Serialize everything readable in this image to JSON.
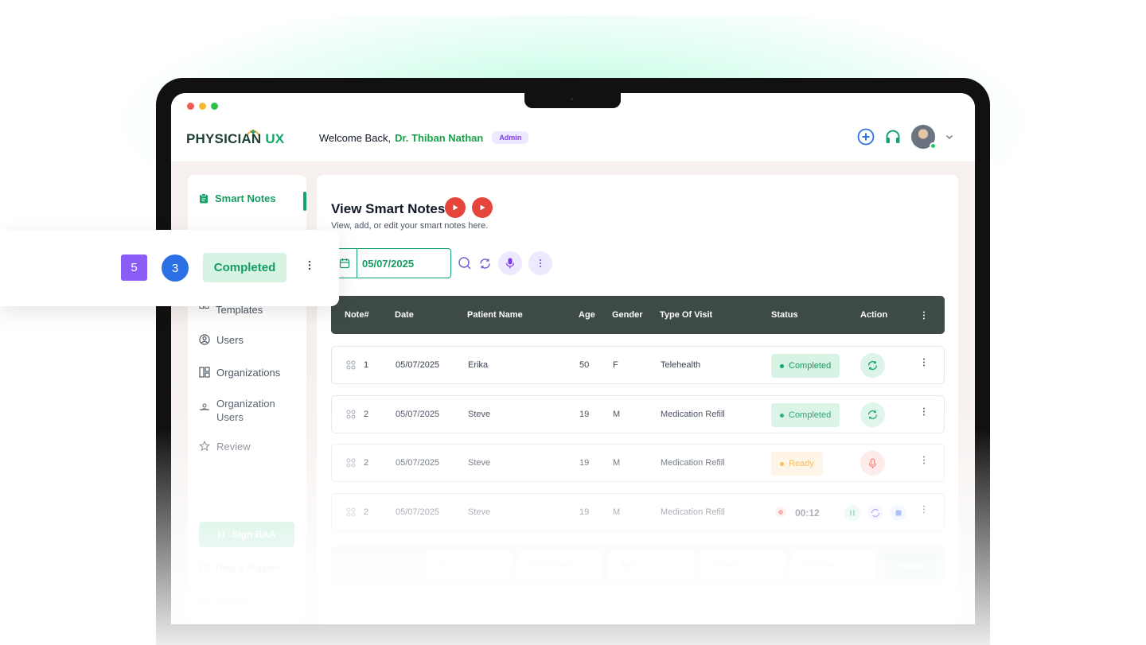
{
  "app": {
    "logo_main": "PHYSICIAN",
    "logo_accent": "UX"
  },
  "header": {
    "welcome_prefix": "Welcome Back,",
    "doctor_name": "Dr. Thiban Nathan",
    "role_badge": "Admin"
  },
  "sidebar": {
    "active_item": "Smart Notes",
    "items": [
      "Templates",
      "Users",
      "Organizations",
      "Organization Users",
      "Review"
    ],
    "sign_baa": "Sign BAA",
    "help": "Help & Support",
    "setting": "Setting"
  },
  "main": {
    "title": "View Smart Notes",
    "subtitle": "View, add, or edit your smart notes here.",
    "date_value": "05/07/2025"
  },
  "table": {
    "columns": [
      "Note#",
      "Date",
      "Patient Name",
      "Age",
      "Gender",
      "Type Of Visit",
      "Status",
      "Action"
    ],
    "rows": [
      {
        "note": "1",
        "date": "05/07/2025",
        "patient": "Erika",
        "age": "50",
        "gender": "F",
        "visit": "Telehealth",
        "status": "Completed"
      },
      {
        "note": "2",
        "date": "05/07/2025",
        "patient": "Steve",
        "age": "19",
        "gender": "M",
        "visit": "Medication Refill",
        "status": "Completed"
      },
      {
        "note": "2",
        "date": "05/07/2025",
        "patient": "Steve",
        "age": "19",
        "gender": "M",
        "visit": "Medication Refill",
        "status": "Ready"
      },
      {
        "note": "2",
        "date": "05/07/2025",
        "patient": "Steve",
        "age": "19",
        "gender": "M",
        "visit": "Medication Refill",
        "status": "",
        "timer": "00:12"
      }
    ]
  },
  "next_patient": {
    "label": "Next Patient:",
    "placeholders": [
      "01",
      "Enter Name",
      "Age",
      "Gender",
      "Visit Type"
    ],
    "add": "+ Add"
  },
  "floating_card": {
    "number": "5",
    "circle": "3",
    "status": "Completed"
  },
  "colors": {
    "brand_green": "#16a36a",
    "header_dark": "#3e4a44",
    "record_red": "#e5453a",
    "purple": "#8b5cf6",
    "blue": "#2b6fe5"
  }
}
